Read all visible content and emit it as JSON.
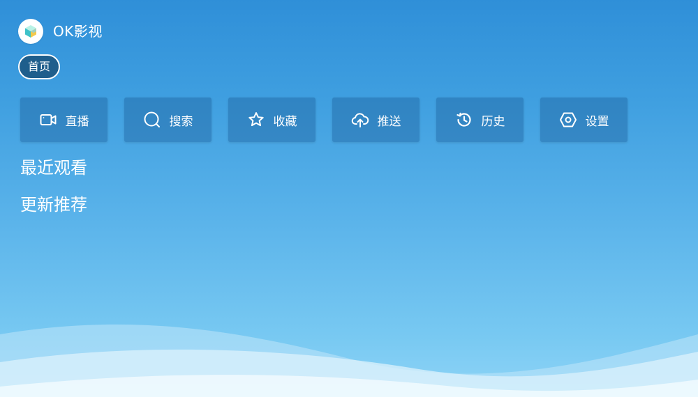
{
  "app": {
    "title": "OK影视",
    "logo_icon": "cube-logo-icon"
  },
  "tabs": [
    {
      "label": "首页",
      "selected": true
    }
  ],
  "toolbar": {
    "buttons": [
      {
        "label": "直播",
        "icon": "video-camera-icon"
      },
      {
        "label": "搜索",
        "icon": "search-icon"
      },
      {
        "label": "收藏",
        "icon": "star-icon"
      },
      {
        "label": "推送",
        "icon": "cloud-upload-icon"
      },
      {
        "label": "历史",
        "icon": "history-icon"
      },
      {
        "label": "设置",
        "icon": "settings-hexagon-icon"
      }
    ]
  },
  "sections": {
    "recent": "最近观看",
    "updates": "更新推荐"
  },
  "colors": {
    "background_top": "#2f8fd8",
    "background_bottom": "#8fd4f6",
    "tab_selected_bg": "#1f5e8c",
    "text": "#ffffff"
  }
}
